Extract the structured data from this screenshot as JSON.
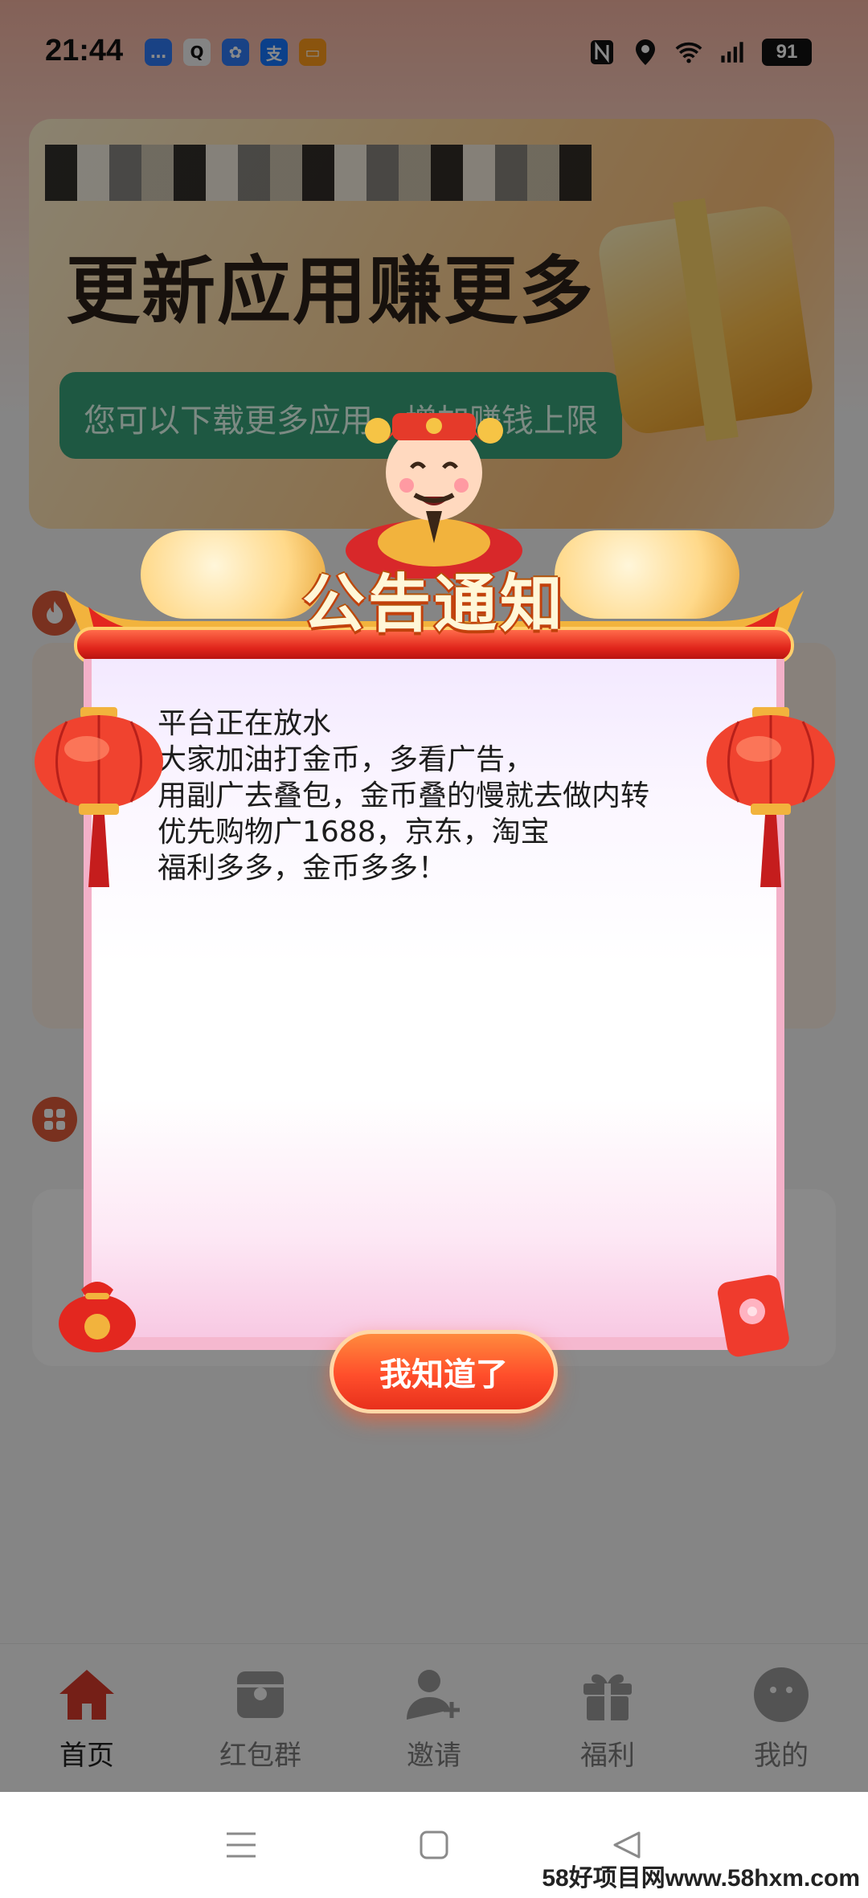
{
  "status_bar": {
    "time": "21:44",
    "apps": [
      {
        "icon": "message-icon",
        "glyph": "…",
        "color": "#2f7bf6"
      },
      {
        "icon": "qq-icon",
        "glyph": "Q",
        "color": "#f4f4f4"
      },
      {
        "icon": "pinwheel-icon",
        "glyph": "✿",
        "color": "#2f7bf6"
      },
      {
        "icon": "alipay-icon",
        "glyph": "支",
        "color": "#1677ff"
      },
      {
        "icon": "wallet-icon",
        "glyph": "▭",
        "color": "#ff9c1a"
      }
    ],
    "battery": "91"
  },
  "banner": {
    "title": "更新应用赚更多",
    "subtitle": "您可以下载更多应用，增加赚钱上限"
  },
  "notice": {
    "title": "公告通知",
    "lines": [
      "平台正在放水",
      "大家加油打金币，多看广告，",
      "用副广去叠包，金币叠的慢就去做内转",
      "优先购物广1688，京东，淘宝",
      "福利多多，金币多多！"
    ],
    "confirm_label": "我知道了"
  },
  "bottom_nav": {
    "items": [
      {
        "label": "首页",
        "icon": "home-icon",
        "active": true
      },
      {
        "label": "红包群",
        "icon": "red-packet-icon",
        "active": false
      },
      {
        "label": "邀请",
        "icon": "invite-user-icon",
        "active": false
      },
      {
        "label": "福利",
        "icon": "gift-icon",
        "active": false
      },
      {
        "label": "我的",
        "icon": "profile-icon",
        "active": false
      }
    ]
  },
  "watermark": "58好项目网www.58hxm.com",
  "colors": {
    "accent": "#e8301c",
    "nav_active": "#d93a2b",
    "nav_inactive": "#9a9a9a"
  }
}
